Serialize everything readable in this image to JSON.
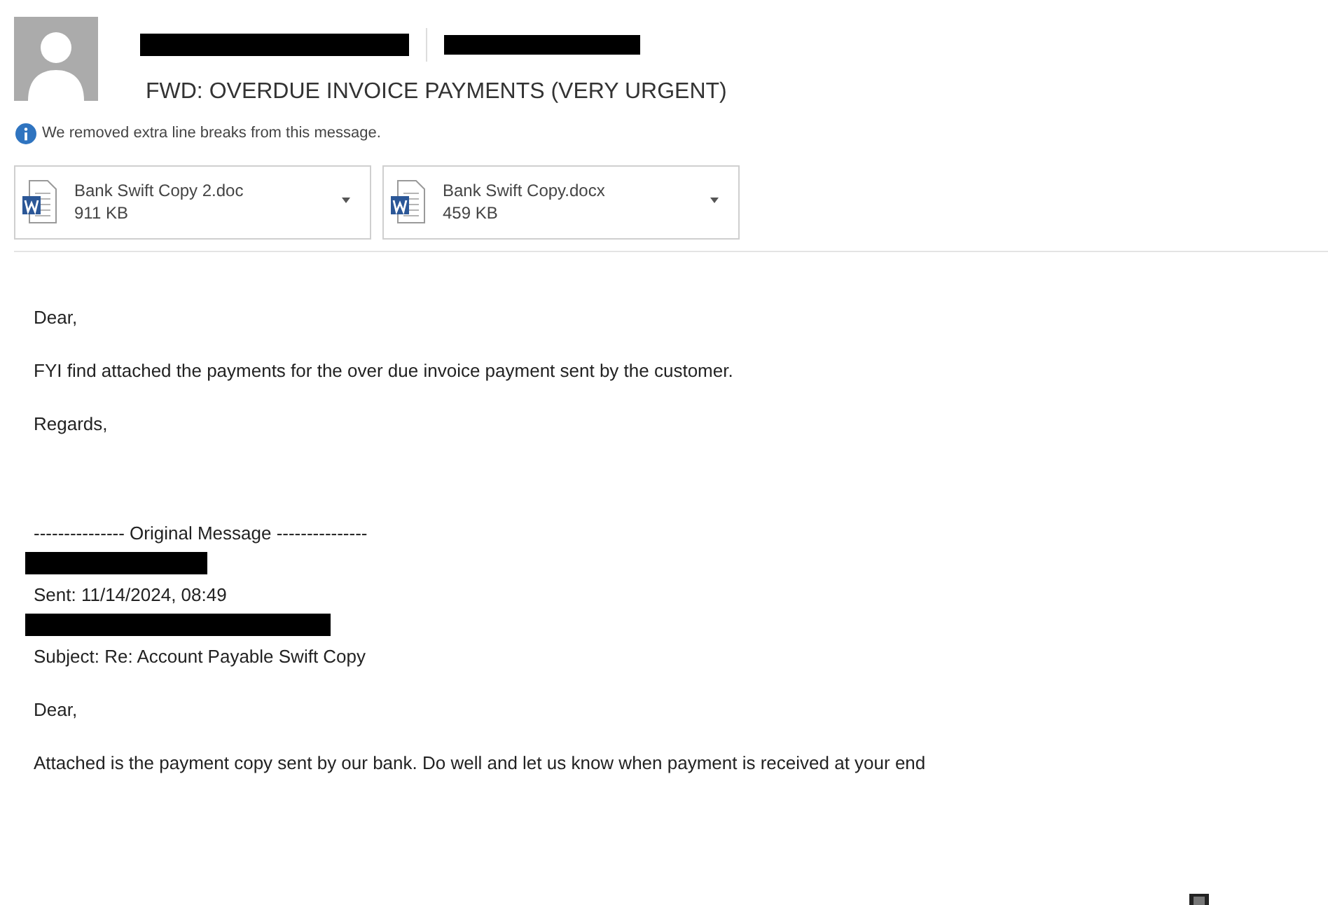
{
  "header": {
    "subject": "FWD: OVERDUE INVOICE PAYMENTS (VERY URGENT)",
    "notice": "We removed extra line breaks from this message."
  },
  "attachments": [
    {
      "name": "Bank Swift Copy 2.doc",
      "size": "911 KB"
    },
    {
      "name": "Bank Swift Copy.docx",
      "size": "459 KB"
    }
  ],
  "body": [
    {
      "kind": "text",
      "text": "Dear,"
    },
    {
      "kind": "text",
      "text": "FYI find attached the payments for the over due invoice payment sent by the customer."
    },
    {
      "kind": "text",
      "text": "Regards,"
    },
    {
      "kind": "gap"
    },
    {
      "kind": "line",
      "text": "--------------- Original Message ---------------"
    },
    {
      "kind": "redacted",
      "wide": false
    },
    {
      "kind": "line",
      "text": "Sent: 11/14/2024, 08:49"
    },
    {
      "kind": "redacted",
      "wide": true
    },
    {
      "kind": "text",
      "text": "Subject: Re: Account Payable Swift Copy"
    },
    {
      "kind": "text",
      "text": "Dear,"
    },
    {
      "kind": "text",
      "text": "Attached is the payment copy sent by our bank. Do well and let us know when payment is received at your end"
    }
  ]
}
